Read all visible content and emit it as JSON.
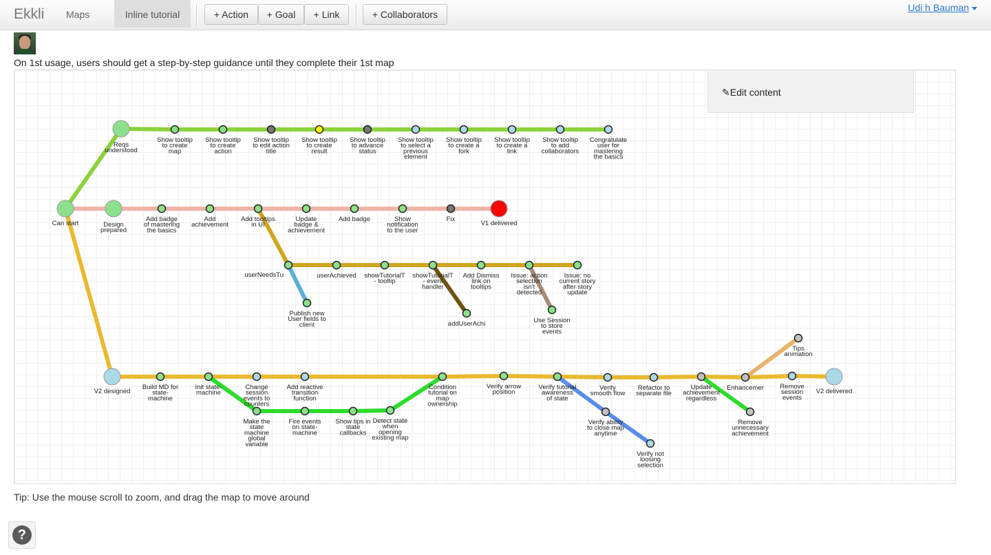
{
  "nav": {
    "brand": "Ekkli",
    "maps": "Maps",
    "active_map": "Inline tutorial",
    "add_action": "+ Action",
    "add_goal": "+ Goal",
    "add_link": "+ Link",
    "add_collaborators": "+ Collaborators",
    "user_name": "Udi h Bauman"
  },
  "map": {
    "description": "On 1st usage, users should get a step-by-step guidance until they complete their 1st map",
    "edit_content": "Edit content",
    "tip": "Tip: Use the mouse scroll to zoom, and drag the map to move around",
    "help": "?"
  },
  "colors": {
    "green_line": "#8dd13c",
    "pink_line": "#efb3a8",
    "yellow_line": "#eab930",
    "olive_line": "#cfa51e",
    "blue_line": "#5b9fd2",
    "dark_line": "#6e5310",
    "brown_line": "#a68c78",
    "bright_green_line": "#2ddc2d",
    "royal_blue_line": "#5a8ced",
    "orange_line": "#eab36c",
    "node_green": "#8de08d",
    "node_light_blue": "#add8e6",
    "node_gray": "#777777",
    "node_yellow": "#ffff00",
    "node_red": "#ff0000",
    "node_silver": "#c0c0c0"
  },
  "diagram": {
    "lines": [
      {
        "color": "#8dd13c",
        "nodes": [
          "can-start",
          "reqs-understood",
          "tt-map",
          "tt-action",
          "tt-edit-title",
          "tt-result",
          "tt-advance",
          "tt-prev",
          "tt-fork",
          "tt-link",
          "tt-collab",
          "congratulate"
        ]
      },
      {
        "color": "#efb3a8",
        "nodes": [
          "can-start",
          "design-prepared",
          "badge-basics",
          "add-achievement",
          "tooltips-ui",
          "update-badge",
          "add-badge",
          "notification",
          "fix",
          "v1-delivered"
        ]
      },
      {
        "color": "#eab930",
        "nodes": [
          "can-start",
          "v2-designed",
          "build-md",
          "init-state",
          "change-events",
          "reactive",
          "condition-tutorial",
          "verify-arrow",
          "verify-awareness",
          "verify-smooth",
          "refactor",
          "update-achievement",
          "enhancemer",
          "remove-events",
          "v2-delivered"
        ]
      },
      {
        "color": "#cfa51e",
        "nodes": [
          "tooltips-ui",
          "user-needs",
          "user-achieved",
          "show-tutorial-tooltip",
          "show-tutorial-event",
          "add-dismiss",
          "issue-selection",
          "issue-story"
        ]
      },
      {
        "color": "#5bafd8",
        "nodes": [
          "user-needs",
          "publish-fields"
        ]
      },
      {
        "color": "#6e5310",
        "nodes": [
          "show-tutorial-event",
          "add-user-achi"
        ]
      },
      {
        "color": "#a68c78",
        "nodes": [
          "issue-selection",
          "use-session"
        ]
      },
      {
        "color": "#2ddc2d",
        "nodes": [
          "init-state",
          "state-global",
          "fire-events",
          "show-tips",
          "detect-state",
          "condition-tutorial"
        ]
      },
      {
        "color": "#5a8ced",
        "nodes": [
          "verify-awareness",
          "verify-close",
          "verify-loosing"
        ]
      },
      {
        "color": "#2ddc2d",
        "nodes": [
          "update-achievement",
          "remove-unnecessary"
        ]
      },
      {
        "color": "#eab36c",
        "nodes": [
          "enhancemer",
          "tips-animation"
        ]
      }
    ],
    "nodes": [
      {
        "id": "can-start",
        "label": [
          "Can start"
        ],
        "fill": "#8de08d",
        "big": true
      },
      {
        "id": "reqs-understood",
        "label": [
          "Reqs",
          "understood"
        ],
        "fill": "#8de08d",
        "big": true
      },
      {
        "id": "tt-map",
        "label": [
          "Show tooltip",
          "to create",
          "map"
        ],
        "fill": "#8de08d"
      },
      {
        "id": "tt-action",
        "label": [
          "Show tooltip",
          "to create",
          "action"
        ],
        "fill": "#8de08d"
      },
      {
        "id": "tt-edit-title",
        "label": [
          "Show tooltip",
          "to edit action",
          "title"
        ],
        "fill": "#777777"
      },
      {
        "id": "tt-result",
        "label": [
          "Show tooltip",
          "to create",
          "result"
        ],
        "fill": "#ffff00"
      },
      {
        "id": "tt-advance",
        "label": [
          "Show tooltip",
          "to advance",
          "status"
        ],
        "fill": "#777777"
      },
      {
        "id": "tt-prev",
        "label": [
          "Show tooltip",
          "to select a",
          "previous",
          "element"
        ],
        "fill": "#add8e6"
      },
      {
        "id": "tt-fork",
        "label": [
          "Show tooltip",
          "to create a",
          "fork"
        ],
        "fill": "#add8e6"
      },
      {
        "id": "tt-link",
        "label": [
          "Show tooltip",
          "to create a",
          "link"
        ],
        "fill": "#add8e6"
      },
      {
        "id": "tt-collab",
        "label": [
          "Show tooltip",
          "to add",
          "collaborators"
        ],
        "fill": "#add8e6"
      },
      {
        "id": "congratulate",
        "label": [
          "Congratulate",
          "user for",
          "mastering",
          "the basics"
        ],
        "fill": "#add8e6"
      },
      {
        "id": "design-prepared",
        "label": [
          "Design",
          "prepared"
        ],
        "fill": "#8de08d",
        "big": true
      },
      {
        "id": "badge-basics",
        "label": [
          "Add badge",
          "of mastering",
          "the basics"
        ],
        "fill": "#8de08d"
      },
      {
        "id": "add-achievement",
        "label": [
          "Add",
          "achievement"
        ],
        "fill": "#8de08d"
      },
      {
        "id": "tooltips-ui",
        "label": [
          "Add tooltips",
          "in UI"
        ],
        "fill": "#8de08d"
      },
      {
        "id": "update-badge",
        "label": [
          "Update",
          "badge &",
          "achievement"
        ],
        "fill": "#8de08d"
      },
      {
        "id": "add-badge",
        "label": [
          "Add badge"
        ],
        "fill": "#8de08d"
      },
      {
        "id": "notification",
        "label": [
          "Show",
          "notification",
          "to the user"
        ],
        "fill": "#8de08d"
      },
      {
        "id": "fix",
        "label": [
          "Fix"
        ],
        "fill": "#777777"
      },
      {
        "id": "v1-delivered",
        "label": [
          "V1 delivered"
        ],
        "fill": "#ff0000",
        "big": true
      },
      {
        "id": "user-needs",
        "label": [
          "userNeedsTu"
        ],
        "fill": "#8de08d",
        "label_left": true
      },
      {
        "id": "user-achieved",
        "label": [
          "userAchieved"
        ],
        "fill": "#8de08d"
      },
      {
        "id": "show-tutorial-tooltip",
        "label": [
          "showTutorialT",
          "- tooltip"
        ],
        "fill": "#8de08d"
      },
      {
        "id": "show-tutorial-event",
        "label": [
          "showTutorialT",
          "- event",
          "handler"
        ],
        "fill": "#8de08d"
      },
      {
        "id": "add-dismiss",
        "label": [
          "Add Dismiss",
          "link on",
          "tooltips"
        ],
        "fill": "#8de08d"
      },
      {
        "id": "issue-selection",
        "label": [
          "Issue: action",
          "selection",
          "isn't",
          "detected"
        ],
        "fill": "#8de08d"
      },
      {
        "id": "issue-story",
        "label": [
          "Issue: no",
          "current story",
          "after story",
          "update"
        ],
        "fill": "#8de08d"
      },
      {
        "id": "publish-fields",
        "label": [
          "Publish new",
          "User fields to",
          "client"
        ],
        "fill": "#8de08d"
      },
      {
        "id": "add-user-achi",
        "label": [
          "addUserAchi"
        ],
        "fill": "#8de08d"
      },
      {
        "id": "use-session",
        "label": [
          "Use Session",
          "to store",
          "events"
        ],
        "fill": "#8de08d"
      },
      {
        "id": "v2-designed",
        "label": [
          "V2 designed"
        ],
        "fill": "#add8e6",
        "big": true
      },
      {
        "id": "build-md",
        "label": [
          "Build MD for",
          "state-",
          "machine"
        ],
        "fill": "#8de08d"
      },
      {
        "id": "init-state",
        "label": [
          "Init state-",
          "machine"
        ],
        "fill": "#8de08d"
      },
      {
        "id": "change-events",
        "label": [
          "Change",
          "session",
          "events to",
          "counters"
        ],
        "fill": "#add8e6"
      },
      {
        "id": "reactive",
        "label": [
          "Add reactive",
          "transition",
          "function"
        ],
        "fill": "#add8e6"
      },
      {
        "id": "condition-tutorial",
        "label": [
          "Condition",
          "tutorial on",
          "map",
          "ownership"
        ],
        "fill": "#8de08d"
      },
      {
        "id": "verify-arrow",
        "label": [
          "Verify arrow",
          "position"
        ],
        "fill": "#8de08d"
      },
      {
        "id": "verify-awareness",
        "label": [
          "Verify tutorial",
          "awareness",
          "of state"
        ],
        "fill": "#8de08d"
      },
      {
        "id": "verify-smooth",
        "label": [
          "Verify",
          "smooth flow"
        ],
        "fill": "#add8e6"
      },
      {
        "id": "refactor",
        "label": [
          "Refactor to",
          "separate file"
        ],
        "fill": "#add8e6"
      },
      {
        "id": "update-achievement",
        "label": [
          "Update",
          "achievement",
          "regardless"
        ],
        "fill": "#c0c0c0"
      },
      {
        "id": "enhancemer",
        "label": [
          "Enhancemer"
        ],
        "fill": "#c0c0c0"
      },
      {
        "id": "remove-events",
        "label": [
          "Remove",
          "session",
          "events"
        ],
        "fill": "#add8e6"
      },
      {
        "id": "v2-delivered",
        "label": [
          "V2 delivered"
        ],
        "fill": "#add8e6",
        "big": true
      },
      {
        "id": "state-global",
        "label": [
          "Make the",
          "state",
          "machine",
          "global",
          "variable"
        ],
        "fill": "#8de08d"
      },
      {
        "id": "fire-events",
        "label": [
          "Fire events",
          "on state-",
          "machine"
        ],
        "fill": "#8de08d"
      },
      {
        "id": "show-tips",
        "label": [
          "Show tips in",
          "state",
          "callbacks"
        ],
        "fill": "#8de08d"
      },
      {
        "id": "detect-state",
        "label": [
          "Detect state",
          "when",
          "opening",
          "existing map"
        ],
        "fill": "#8de08d"
      },
      {
        "id": "verify-close",
        "label": [
          "Verify ability",
          "to close map",
          "anytime"
        ],
        "fill": "#c0c0c0"
      },
      {
        "id": "verify-loosing",
        "label": [
          "Verify not",
          "loosing",
          "selection"
        ],
        "fill": "#add8e6"
      },
      {
        "id": "remove-unnecessary",
        "label": [
          "Remove",
          "unnecessary",
          "achievement"
        ],
        "fill": "#c0c0c0"
      },
      {
        "id": "tips-animation",
        "label": [
          "Tips",
          "animation"
        ],
        "fill": "#c0c0c0"
      }
    ]
  }
}
